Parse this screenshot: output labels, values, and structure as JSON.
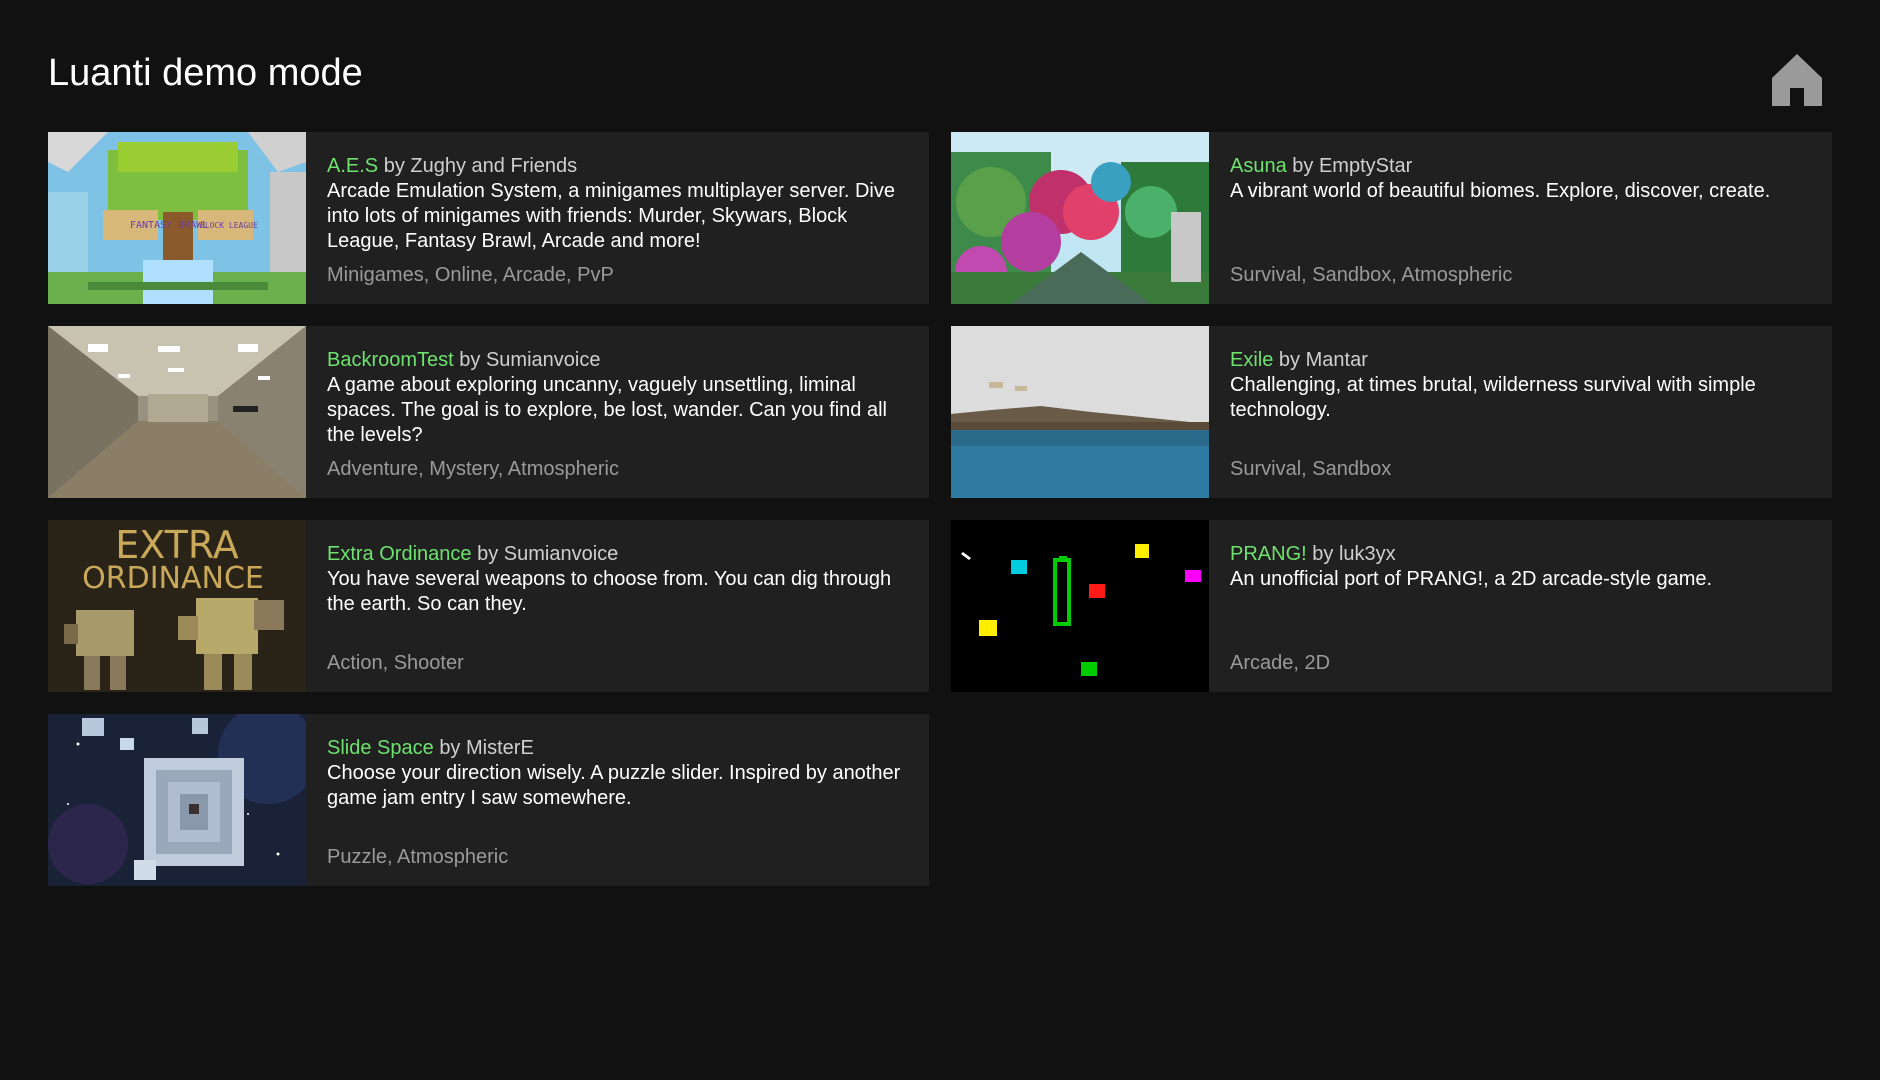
{
  "header": {
    "title": "Luanti demo mode",
    "home_icon": "home-icon"
  },
  "colors": {
    "background": "#111111",
    "card": "#202020",
    "game_name": "#6ee26e",
    "tags": "#9a9a9a"
  },
  "games": [
    {
      "name": "A.E.S",
      "by": "by",
      "author": "Zughy and Friends",
      "description": "Arcade Emulation System, a minigames multiplayer server. Dive into lots of minigames with friends: Murder, Skywars, Block League, Fantasy Brawl, Arcade and more!",
      "tags": "Minigames, Online, Arcade, PvP",
      "thumb_text": [
        "FANTASY BRAWL",
        "BLOCK LEAGUE"
      ]
    },
    {
      "name": "Asuna",
      "by": "by",
      "author": "EmptyStar",
      "description": "A vibrant world of beautiful biomes. Explore, discover, create.",
      "tags": "Survival, Sandbox, Atmospheric"
    },
    {
      "name": "BackroomTest",
      "by": "by",
      "author": "Sumianvoice",
      "description": "A game about exploring uncanny, vaguely unsettling, liminal spaces. The goal is to explore, be lost, wander. Can you find all the levels?",
      "tags": "Adventure, Mystery, Atmospheric"
    },
    {
      "name": "Exile",
      "by": "by",
      "author": "Mantar",
      "description": "Challenging, at times brutal, wilderness survival with simple technology.",
      "tags": "Survival, Sandbox"
    },
    {
      "name": "Extra Ordinance",
      "by": "by",
      "author": "Sumianvoice",
      "description": "You have several weapons to choose from. You can dig through the earth. So can they.",
      "tags": "Action, Shooter",
      "thumb_text": [
        "EXTRA",
        "ORDINANCE"
      ]
    },
    {
      "name": "PRANG!",
      "by": "by",
      "author": "luk3yx",
      "description": "An unofficial port of PRANG!, a 2D arcade-style game.",
      "tags": "Arcade, 2D"
    },
    {
      "name": "Slide Space",
      "by": "by",
      "author": "MisterE",
      "description": "Choose your direction wisely. A puzzle slider. Inspired by another game jam entry I saw somewhere.",
      "tags": "Puzzle, Atmospheric"
    }
  ]
}
